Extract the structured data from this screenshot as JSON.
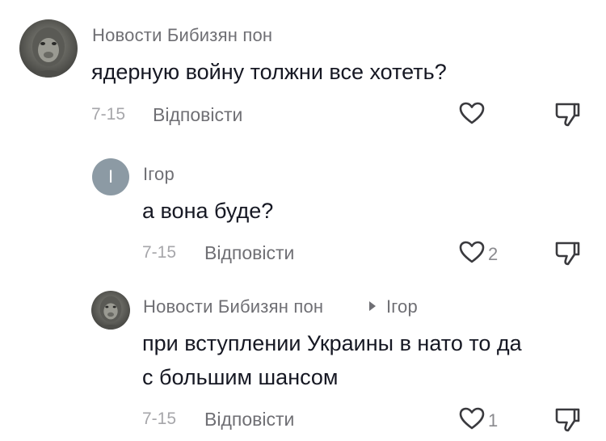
{
  "comments": [
    {
      "author": "Новости Бибизян пон",
      "text": "ядерную войну толжни все хотеть?",
      "date": "7-15",
      "reply_label": "Відповісти",
      "likes": ""
    },
    {
      "author": "Ігор",
      "avatar_letter": "І",
      "text": "а вона буде?",
      "date": "7-15",
      "reply_label": "Відповісти",
      "likes": "2"
    },
    {
      "author": "Новости Бибизян пон",
      "reply_to": "Ігор",
      "text_lines": [
        "при вступлении Украины в нато то да",
        "с большим шансом"
      ],
      "date": "7-15",
      "reply_label": "Відповісти",
      "likes": "1"
    }
  ],
  "icons": {
    "like": "heart-outline-icon",
    "dislike": "thumbs-down-icon",
    "reply_arrow": "triangle-right-icon"
  },
  "colors": {
    "text_primary": "#161823",
    "text_secondary": "#6f6f74",
    "date": "#a6a6aa",
    "letter_avatar_bg": "#8c9aa4"
  }
}
